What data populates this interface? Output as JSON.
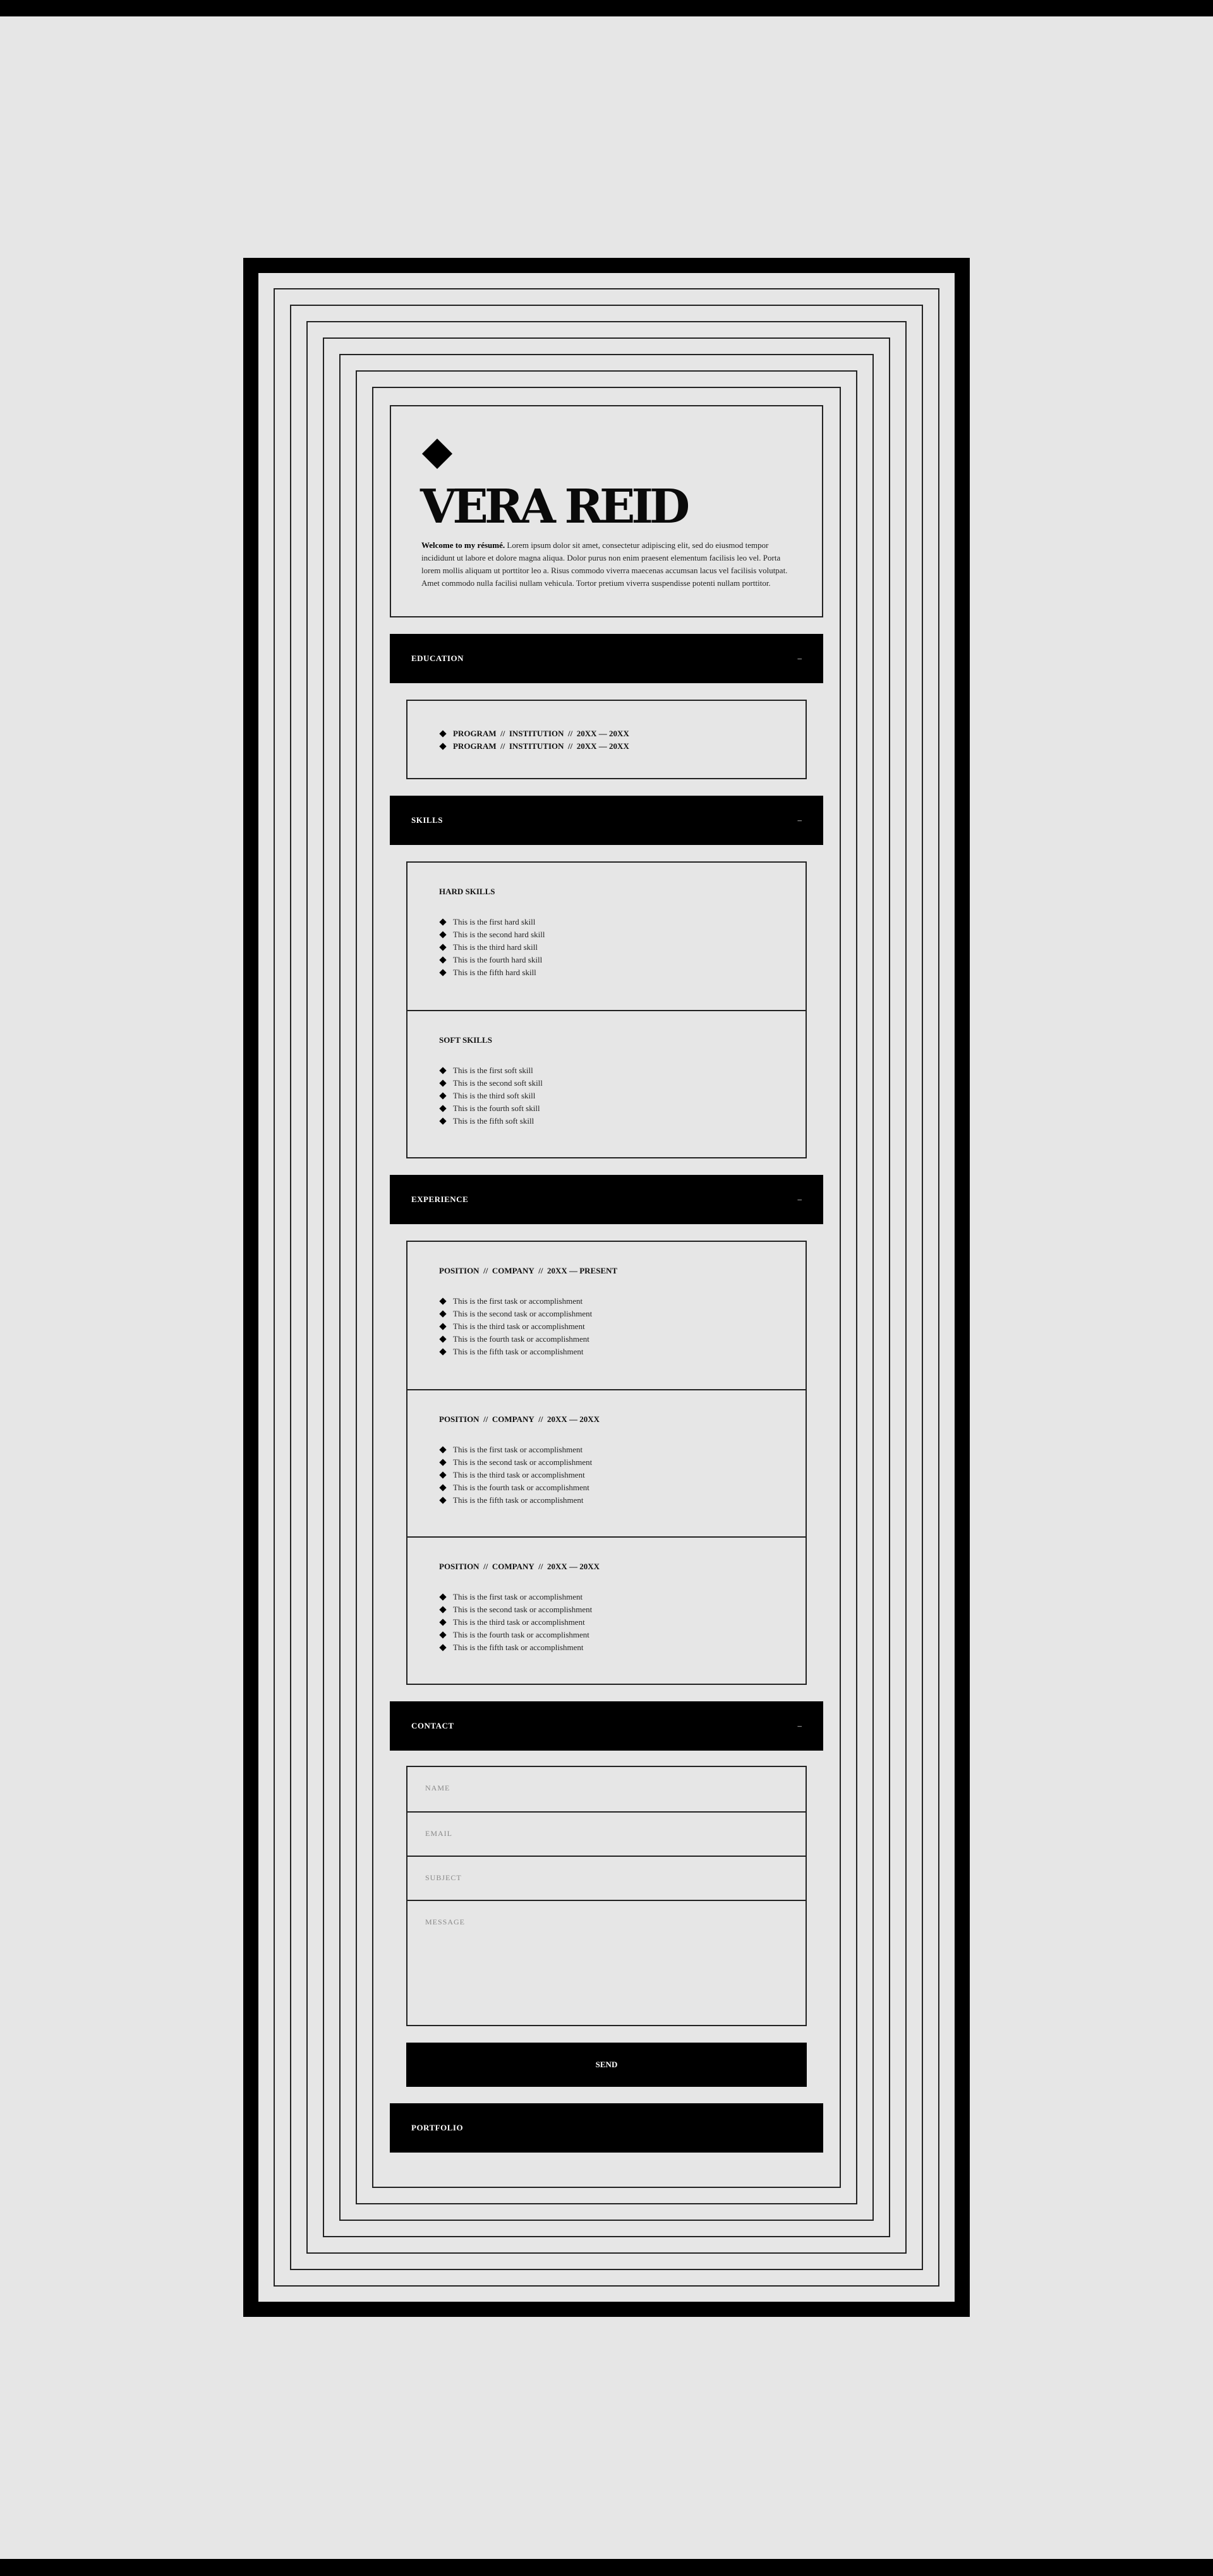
{
  "profile": {
    "name": "VERA REID",
    "welcome": "Welcome to my résumé.",
    "intro": " Lorem ipsum dolor sit amet, consectetur adipiscing elit, sed do eiusmod tempor incididunt ut labore et dolore magna aliqua. Dolor purus non enim praesent elementum facilisis leo vel. Porta lorem mollis aliquam ut porttitor leo a. Risus commodo viverra maecenas accumsan lacus vel facilisis volutpat. Amet commodo nulla facilisi nullam vehicula. Tortor pretium viverra suspendisse potenti nullam porttitor."
  },
  "education": {
    "title": "EDUCATION",
    "toggle": "–",
    "entries": [
      {
        "program": "PROGRAM",
        "institution": "INSTITUTION",
        "dates": "20XX — 20XX"
      },
      {
        "program": "PROGRAM",
        "institution": "INSTITUTION",
        "dates": "20XX — 20XX"
      }
    ]
  },
  "skills": {
    "title": "SKILLS",
    "toggle": "–",
    "hard": {
      "title": "HARD SKILLS",
      "items": [
        "This is the first hard skill",
        "This is the second hard skill",
        "This is the third hard skill",
        "This is the fourth hard skill",
        "This is the fifth hard skill"
      ]
    },
    "soft": {
      "title": "SOFT SKILLS",
      "items": [
        "This is the first soft skill",
        "This is the second soft skill",
        "This is the third soft skill",
        "This is the fourth soft skill",
        "This is the fifth soft skill"
      ]
    }
  },
  "experience": {
    "title": "EXPERIENCE",
    "toggle": "–",
    "separator": "//",
    "jobs": [
      {
        "position": "POSITION",
        "company": "COMPANY",
        "dates": "20XX — PRESENT",
        "tasks": [
          "This is the first task or accomplishment",
          "This is the second task or accomplishment",
          "This is the third task or accomplishment",
          "This is the fourth task or accomplishment",
          "This is the fifth task or accomplishment"
        ]
      },
      {
        "position": "POSITION",
        "company": "COMPANY",
        "dates": "20XX — 20XX",
        "tasks": [
          "This is the first task or accomplishment",
          "This is the second task or accomplishment",
          "This is the third task or accomplishment",
          "This is the fourth task or accomplishment",
          "This is the fifth task or accomplishment"
        ]
      },
      {
        "position": "POSITION",
        "company": "COMPANY",
        "dates": "20XX — 20XX",
        "tasks": [
          "This is the first task or accomplishment",
          "This is the second task or accomplishment",
          "This is the third task or accomplishment",
          "This is the fourth task or accomplishment",
          "This is the fifth task or accomplishment"
        ]
      }
    ]
  },
  "contact": {
    "title": "CONTACT",
    "toggle": "–",
    "fields": {
      "name": "NAME",
      "email": "EMAIL",
      "subject": "SUBJECT",
      "message": "MESSAGE"
    },
    "send_label": "SEND"
  },
  "portfolio": {
    "title": "PORTFOLIO"
  }
}
